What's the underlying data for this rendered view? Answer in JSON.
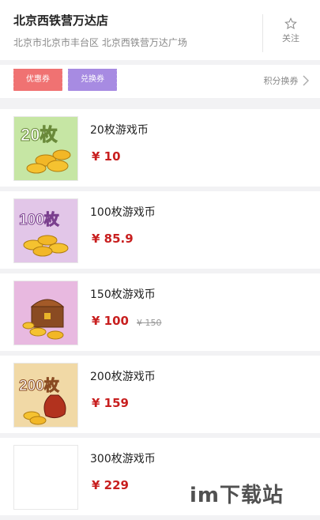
{
  "store": {
    "name": "北京西铁营万达店",
    "address": "北京市北京市丰台区 北京西铁营万达广场",
    "follow_label": "关注"
  },
  "coupons": {
    "coupon_label": "优惠券",
    "exchange_label": "兑换券",
    "points_link": "积分换券"
  },
  "products": [
    {
      "name": "20枚游戏币",
      "price": "¥ 10",
      "thumb_text": "20枚",
      "thumb_color": "#c6e6a4"
    },
    {
      "name": "100枚游戏币",
      "price": "¥ 85.9",
      "thumb_text": "100枚",
      "thumb_color": "#e2c6e8"
    },
    {
      "name": "150枚游戏币",
      "price": "¥ 100",
      "orig_price": "¥ 150",
      "thumb_color": "#e8b9e0"
    },
    {
      "name": "200枚游戏币",
      "price": "¥ 159",
      "thumb_text": "200枚",
      "thumb_color": "#f1d9a6"
    },
    {
      "name": "300枚游戏币",
      "price": "¥ 229"
    }
  ],
  "watermark": "im下载站"
}
